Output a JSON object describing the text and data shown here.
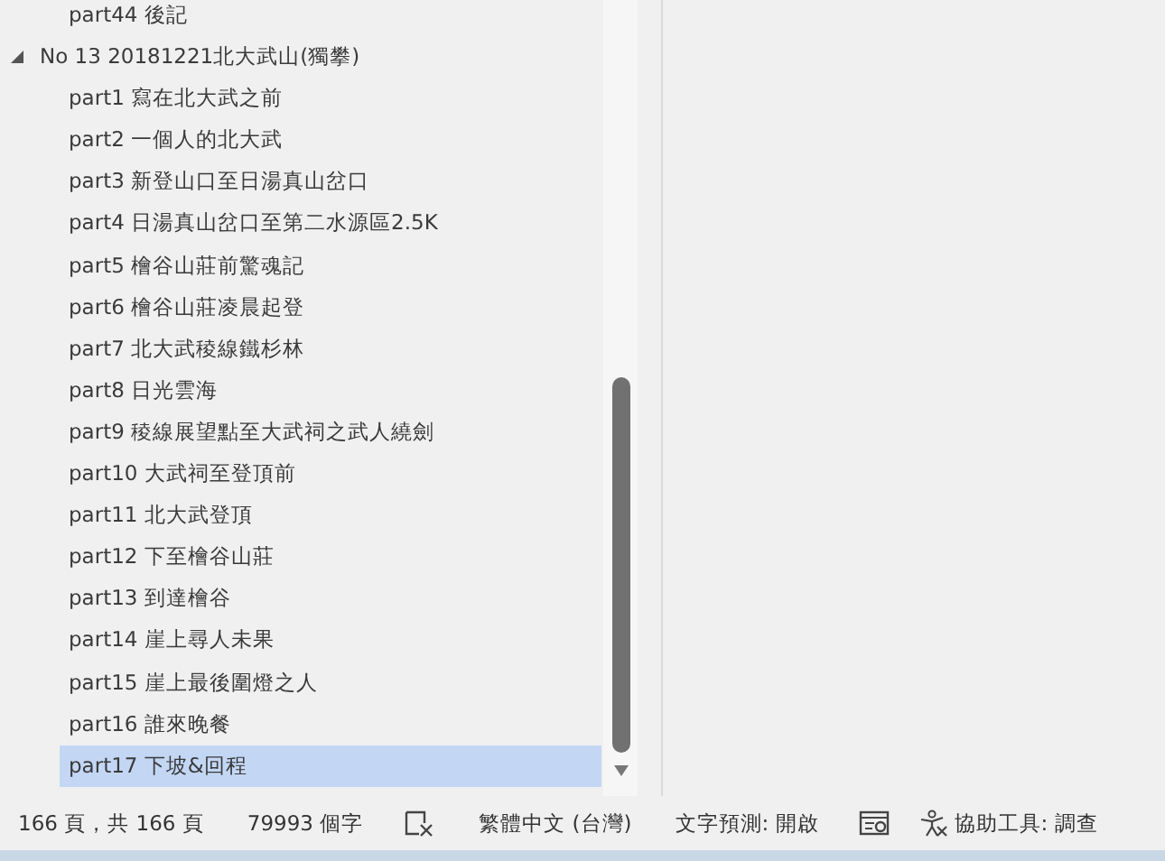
{
  "navigation_tree": [
    {
      "children": [
        {
          "label": "part44 後記",
          "selected": false
        }
      ]
    },
    {
      "label": "No 13 20181221北大武山(獨攀)",
      "expanded": true,
      "selected": false,
      "children": [
        {
          "label": "part1 寫在北大武之前",
          "selected": false
        },
        {
          "label": "part2 一個人的北大武",
          "selected": false
        },
        {
          "label": "part3 新登山口至日湯真山岔口",
          "selected": false
        },
        {
          "label": "part4 日湯真山岔口至第二水源區2.5K",
          "selected": false
        },
        {
          "label": "part5 檜谷山莊前驚魂記",
          "selected": false
        },
        {
          "label": "part6 檜谷山莊凌晨起登",
          "selected": false
        },
        {
          "label": "part7 北大武稜線鐵杉林",
          "selected": false
        },
        {
          "label": "part8 日光雲海",
          "selected": false
        },
        {
          "label": "part9 稜線展望點至大武祠之武人繞劍",
          "selected": false
        },
        {
          "label": "part10 大武祠至登頂前",
          "selected": false
        },
        {
          "label": "part11 北大武登頂",
          "selected": false
        },
        {
          "label": "part12 下至檜谷山莊",
          "selected": false
        },
        {
          "label": "part13 到達檜谷",
          "selected": false
        },
        {
          "label": "part14 崖上尋人未果",
          "selected": false
        },
        {
          "label": "part15 崖上最後圍燈之人",
          "selected": false
        },
        {
          "label": "part16 誰來晚餐",
          "selected": false
        },
        {
          "label": "part17 下坡&回程",
          "selected": true
        }
      ]
    }
  ],
  "status_bar": [
    {
      "kind": "text",
      "text": "166 頁，共 166 頁"
    },
    {
      "kind": "text",
      "text": "79993 個字"
    },
    {
      "kind": "proofing"
    },
    {
      "kind": "text",
      "text": "繁體中文 (台灣)"
    },
    {
      "kind": "text",
      "text": "文字預測: 開啟"
    },
    {
      "kind": "focus"
    },
    {
      "kind": "accessibility",
      "text": "協助工具: 調查"
    }
  ]
}
